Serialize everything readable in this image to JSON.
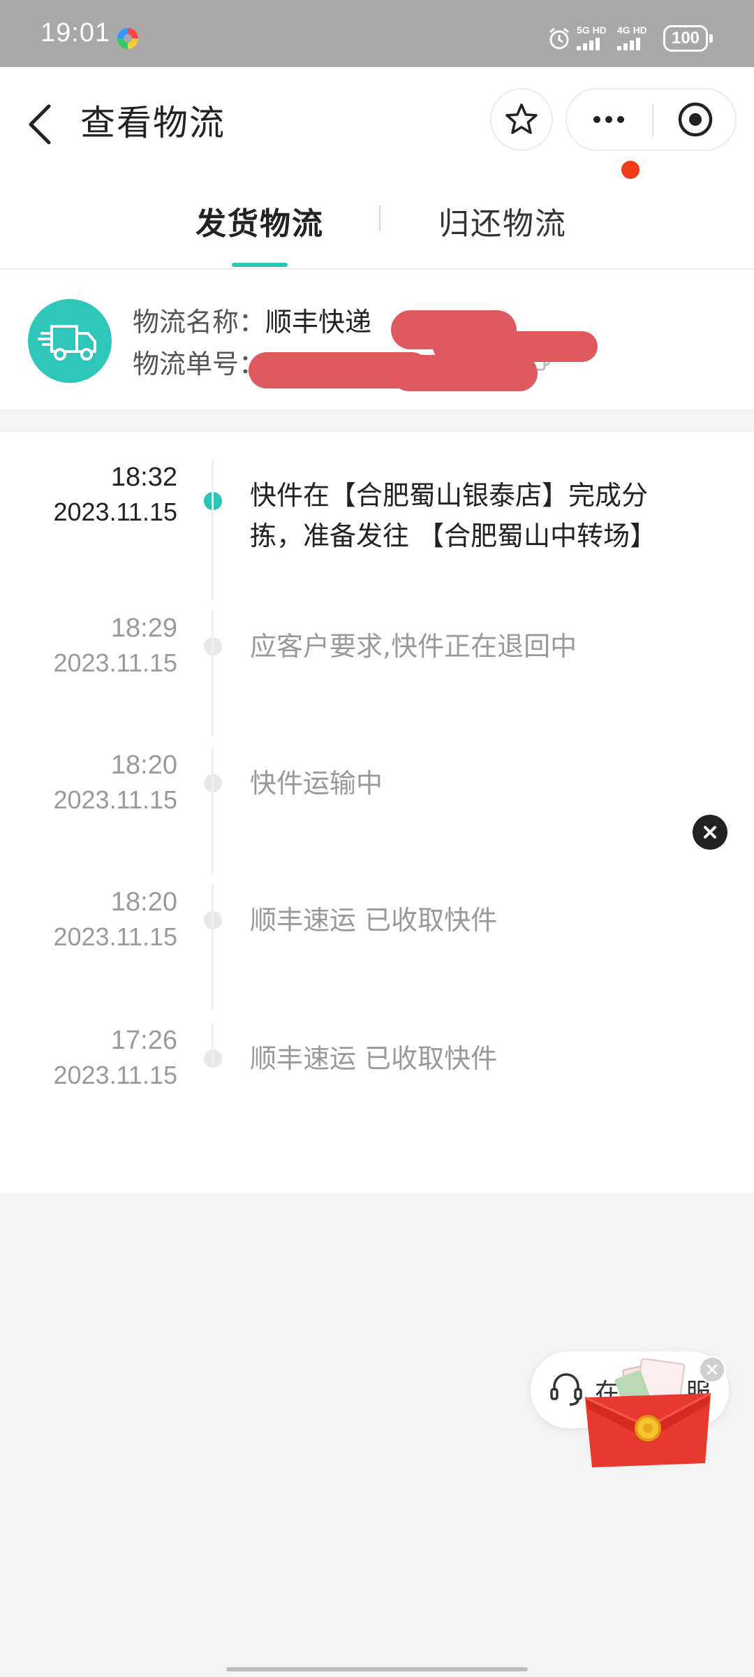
{
  "status_bar": {
    "time": "19:01",
    "signal_1": "5G HD",
    "signal_2": "4G HD",
    "battery": "100"
  },
  "header": {
    "title": "查看物流",
    "tabs": [
      {
        "label": "发货物流",
        "active": true
      },
      {
        "label": "归还物流",
        "active": false
      }
    ]
  },
  "courier": {
    "name_label": "物流名称：",
    "name_value": "顺丰快递",
    "number_label": "物流单号：",
    "number_value": "SF"
  },
  "timeline": [
    {
      "time": "18:32",
      "date": "2023.11.15",
      "text": "快件在【合肥蜀山银泰店】完成分拣，准备发往 【合肥蜀山中转场】",
      "active": true
    },
    {
      "time": "18:29",
      "date": "2023.11.15",
      "text": "应客户要求,快件正在退回中",
      "active": false
    },
    {
      "time": "18:20",
      "date": "2023.11.15",
      "text": "快件运输中",
      "active": false
    },
    {
      "time": "18:20",
      "date": "2023.11.15",
      "text": "顺丰速运 已收取快件",
      "active": false
    },
    {
      "time": "17:26",
      "date": "2023.11.15",
      "text": "顺丰速运 已收取快件",
      "active": false
    }
  ],
  "service": {
    "label_left": "在",
    "label_right": "服"
  },
  "colors": {
    "accent": "#2cc4b6",
    "redaction": "#df5a5f",
    "badge": "#f03c1e"
  }
}
